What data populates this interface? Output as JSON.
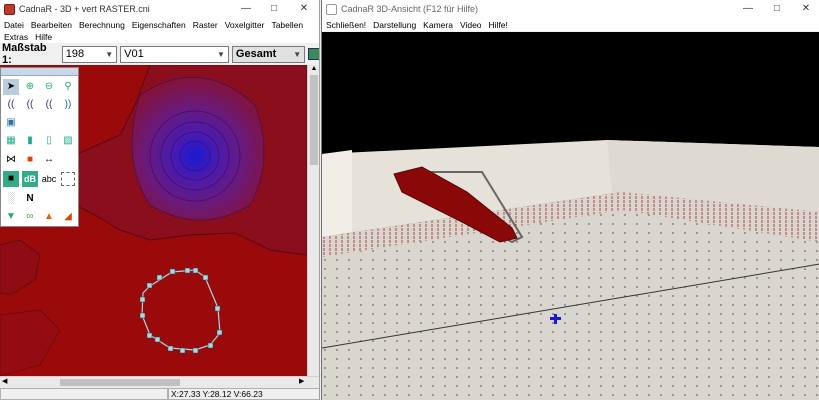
{
  "left_window": {
    "title": "CadnaR - 3D + vert RASTER.cni",
    "menu": [
      "Datei",
      "Bearbeiten",
      "Berechnung",
      "Eigenschaften",
      "Raster",
      "Voxelgitter",
      "Tabellen",
      "Extras",
      "Hilfe"
    ],
    "scale_label": "Maßstab 1:",
    "scale_value": "198",
    "variant_value": "V01",
    "view_value": "Gesamt",
    "status_coords": "X:27.33 Y:28.12 V:66.23",
    "palette_text_tool": "abc",
    "palette_db_tool": "dB",
    "palette_north_tool": "N"
  },
  "right_window": {
    "title": "CadnaR 3D-Ansicht (F12 für Hilfe)",
    "menu": [
      "Schließen!",
      "Darstellung",
      "Kamera",
      "Video",
      "Hilfe!"
    ]
  },
  "colors": {
    "map_red": "#9b0a0a",
    "contour_purple": "#5a1a7a",
    "source_blue": "#1a1ad0",
    "polygon_handles": "#a8d8e0",
    "floor": "#d9d6cf",
    "wall": "#e6e2da",
    "sky": "#000000"
  },
  "icons": {
    "window_controls": [
      "minimize-icon",
      "maximize-icon",
      "close-icon"
    ]
  }
}
